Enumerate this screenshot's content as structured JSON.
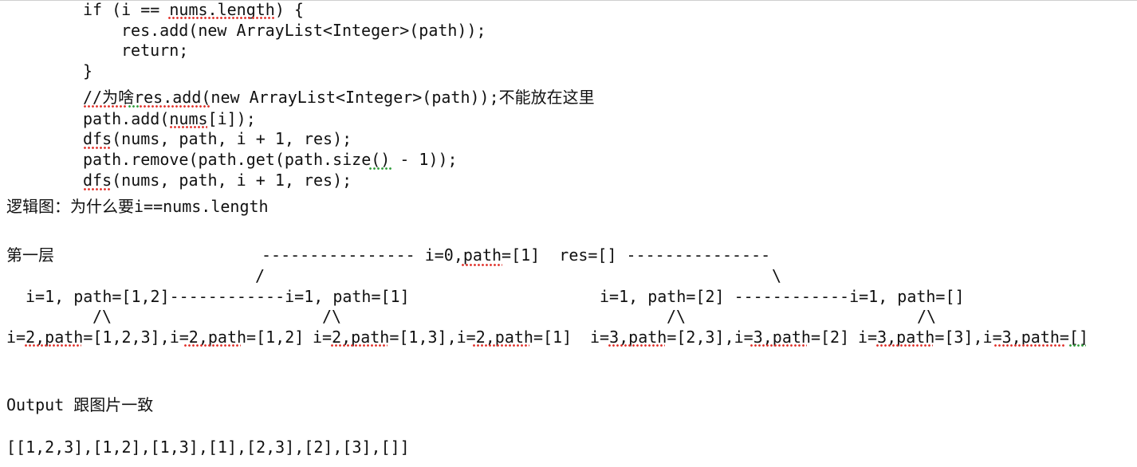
{
  "code_lines": [
    "if (i == nums.length) {",
    "res.add(new ArrayList<Integer>(path));",
    "return;",
    "}",
    "//为啥res.add(new ArrayList<Integer>(path));不能放在这里",
    "path.add(nums[i]);",
    "dfs(nums, path, i + 1, res);",
    "path.remove(path.get(path.size() - 1));",
    "dfs(nums, path, i + 1, res);"
  ],
  "logic_heading": "逻辑图：为什么要i==nums.length",
  "tree": {
    "level_label": "第一层",
    "root_line": "---------------- i=0,path=[1]  res=[] ---------------",
    "root_left_slash": "/",
    "root_right_slash": "\\",
    "level1_left": "i=1, path=[1,2]------------i=1, path=[1]",
    "level1_right": "i=1, path=[2] ------------i=1, path=[]",
    "branch": "/\\",
    "leaves": [
      "i=2,path=[1,2,3],i=2,path=[1,2]",
      "i=2,path=[1,3],i=2,path=[1]",
      "i=3,path=[2,3],i=3,path=[2]",
      "i=3,path=[3],i=3,path=[]"
    ]
  },
  "output_label": "Output 跟图片一致",
  "output_value": "[[1,2,3],[1,2],[1,3],[1],[2,3],[2],[3],[]]",
  "colors": {
    "spell_error": "#e0312a",
    "grammar_hint": "#2f9d3a"
  }
}
